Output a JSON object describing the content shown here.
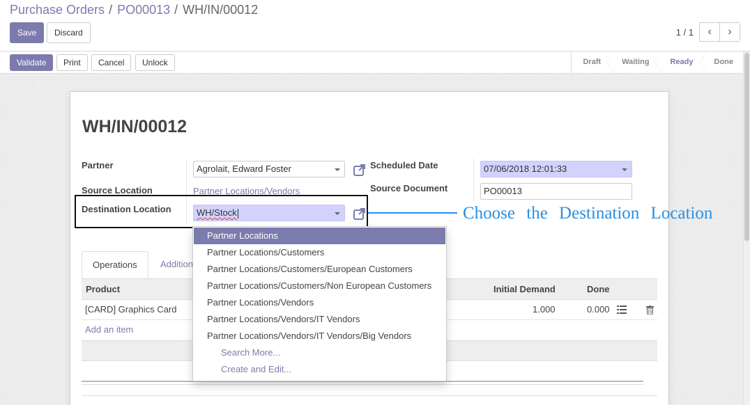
{
  "breadcrumb": {
    "items": [
      "Purchase Orders",
      "PO00013",
      "WH/IN/00012"
    ]
  },
  "toolbar": {
    "save_label": "Save",
    "discard_label": "Discard"
  },
  "pager": {
    "value": "1 / 1"
  },
  "statusbar": {
    "buttons": [
      "Validate",
      "Print",
      "Cancel",
      "Unlock"
    ],
    "stages": [
      "Draft",
      "Waiting",
      "Ready",
      "Done"
    ],
    "active_stage": "Ready"
  },
  "form": {
    "title": "WH/IN/00012",
    "partner_label": "Partner",
    "partner_value": "Agrolait, Edward Foster",
    "source_location_label": "Source Location",
    "source_location_value": "Partner Locations/Vendors",
    "destination_location_label": "Destination Location",
    "destination_location_value": "WH/Stock",
    "scheduled_date_label": "Scheduled Date",
    "scheduled_date_value": "07/06/2018 12:01:33",
    "source_document_label": "Source Document",
    "source_document_value": "PO00013"
  },
  "tabs": [
    {
      "label": "Operations"
    },
    {
      "label": "Addition"
    }
  ],
  "operations": {
    "headers": {
      "product": "Product",
      "initial_demand": "Initial Demand",
      "done": "Done"
    },
    "rows": [
      {
        "product": "[CARD] Graphics Card",
        "initial_demand": "1.000",
        "done": "0.000"
      }
    ],
    "add_item_label": "Add an item"
  },
  "dropdown": {
    "options": [
      "Partner Locations",
      "Partner Locations/Customers",
      "Partner Locations/Customers/European Customers",
      "Partner Locations/Customers/Non European Customers",
      "Partner Locations/Vendors",
      "Partner Locations/Vendors/IT Vendors",
      "Partner Locations/Vendors/IT Vendors/Big Vendors"
    ],
    "search_more": "Search More...",
    "create_edit": "Create and Edit..."
  },
  "annotation": {
    "text": "Choose the Destination Location"
  },
  "colors": {
    "accent": "#7c7bad",
    "selected_field": "#d2d2ff",
    "annotation": "#2a8fe0"
  }
}
